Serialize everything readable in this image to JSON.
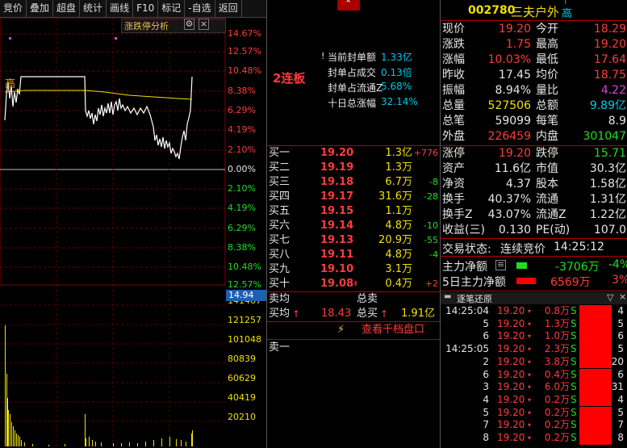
{
  "toolbar": {
    "items": [
      "竞价",
      "叠加",
      "超盘",
      "统计",
      "画线",
      "F10",
      "标记",
      "-自选",
      "返回"
    ]
  },
  "chart": {
    "panel_title": "涨跌停分析",
    "gear_icon": "⚙",
    "close_icon": "×",
    "high_marker": "高",
    "price_axis": [
      "14.67%",
      "12.57%",
      "10.48%",
      "8.38%",
      "6.29%",
      "4.19%",
      "2.10%",
      "0.00%",
      "2.10%",
      "4.19%",
      "6.29%",
      "8.38%",
      "10.48%",
      "12.57%"
    ],
    "volume_badge": "14.94",
    "volume_axis": [
      "141467",
      "121257",
      "101048",
      "80839",
      "60629",
      "40419",
      "20210"
    ]
  },
  "seal_info": {
    "streak": "2连板",
    "lines": [
      {
        "label": "当前封单额",
        "value": "1.33亿"
      },
      {
        "label": "封单占成交",
        "value": "0.13倍"
      },
      {
        "label": "封单占流通Z",
        "value": "5.68%"
      },
      {
        "label": "十日总涨幅",
        "value": "32.14%"
      }
    ]
  },
  "order_book": {
    "bids": [
      {
        "label": "买一",
        "price": "19.20",
        "vol": "1.3亿",
        "chg": "+776"
      },
      {
        "label": "买二",
        "price": "19.19",
        "vol": "1.3万",
        "chg": ""
      },
      {
        "label": "买三",
        "price": "19.18",
        "vol": "6.7万",
        "chg": "-8"
      },
      {
        "label": "买四",
        "price": "19.17",
        "vol": "31.6万",
        "chg": "-28"
      },
      {
        "label": "买五",
        "price": "19.15",
        "vol": "1.1万",
        "chg": ""
      },
      {
        "label": "买六",
        "price": "19.14",
        "vol": "4.8万",
        "chg": "-10"
      },
      {
        "label": "买七",
        "price": "19.13",
        "vol": "20.9万",
        "chg": "-55"
      },
      {
        "label": "买八",
        "price": "19.11",
        "vol": "4.8万",
        "chg": "-4"
      },
      {
        "label": "买九",
        "price": "19.10",
        "vol": "3.1万",
        "chg": ""
      },
      {
        "label": "买十",
        "price": "19.08",
        "vol": "0.4万",
        "chg": "+2"
      }
    ],
    "sell_avg_label": "卖均",
    "total_sell_label": "总卖",
    "buy_avg_label": "买均",
    "buy_avg_price": "18.43",
    "total_buy_label": "总买",
    "total_buy_value": "1.91亿",
    "thousand_btn": "查看千档盘口",
    "ask1_label": "卖一"
  },
  "stock": {
    "code": "002780",
    "name": "三夫户外",
    "flag": "高",
    "flag_top": "T"
  },
  "quote": [
    {
      "l1": "现价",
      "v1": "19.20",
      "c1": "red",
      "l2": "今开",
      "v2": "18.29",
      "c2": "red"
    },
    {
      "l1": "涨跌",
      "v1": "1.75",
      "c1": "red",
      "l2": "最高",
      "v2": "19.20",
      "c2": "red"
    },
    {
      "l1": "涨幅",
      "v1": "10.03%",
      "c1": "red",
      "l2": "最低",
      "v2": "17.64",
      "c2": "red"
    },
    {
      "l1": "昨收",
      "v1": "17.45",
      "c1": "white",
      "l2": "均价",
      "v2": "18.75",
      "c2": "red"
    },
    {
      "l1": "振幅",
      "v1": "8.94%",
      "c1": "white",
      "l2": "量比",
      "v2": "4.22",
      "c2": "magenta"
    },
    {
      "l1": "总量",
      "v1": "527506",
      "c1": "yellow",
      "l2": "总额",
      "v2": "9.89亿",
      "c2": "cyan"
    },
    {
      "l1": "总笔",
      "v1": "59099",
      "c1": "white",
      "l2": "每笔",
      "v2": "8.9",
      "c2": "white"
    },
    {
      "l1": "外盘",
      "v1": "226459",
      "c1": "red",
      "l2": "内盘",
      "v2": "301047",
      "c2": "green"
    },
    {
      "l1": "涨停",
      "v1": "19.20",
      "c1": "red",
      "l2": "跌停",
      "v2": "15.71",
      "c2": "green"
    },
    {
      "l1": "资产",
      "v1": "11.6亿",
      "c1": "white",
      "l2": "市值",
      "v2": "30.3亿",
      "c2": "white"
    },
    {
      "l1": "净资",
      "v1": "4.37",
      "c1": "white",
      "l2": "股本",
      "v2": "1.58亿",
      "c2": "white"
    },
    {
      "l1": "换手",
      "v1": "40.37%",
      "c1": "white",
      "l2": "流通",
      "v2": "1.31亿",
      "c2": "white"
    },
    {
      "l1": "换手Z",
      "v1": "43.07%",
      "c1": "white",
      "l2": "流通Z",
      "v2": "1.22亿",
      "c2": "white"
    },
    {
      "l1": "收益(三)",
      "v1": "0.130",
      "c1": "white",
      "l2": "PE(动)",
      "v2": "107.0",
      "c2": "white"
    }
  ],
  "status": {
    "label": "交易状态:",
    "value": "连续竞价",
    "time": "14:25:12"
  },
  "capital": {
    "main_label": "主力净额",
    "main_value": "-3706万",
    "main_pct": "-4%",
    "five_label": "5日主力净额",
    "five_value": "6569万",
    "five_pct": "3%"
  },
  "ticks_panel": {
    "title": "逐笔还原",
    "filter_icon": "filter-icon",
    "rows": [
      {
        "time": "14:25:04",
        "price": "19.20",
        "vol": "0.8万",
        "cnt": "4",
        "side": "S"
      },
      {
        "time": "5",
        "price": "19.20",
        "vol": "1.3万",
        "cnt": "5",
        "side": "S"
      },
      {
        "time": "6",
        "price": "19.20",
        "vol": "1.0万",
        "cnt": "6",
        "side": "S"
      },
      {
        "time": "14:25:05",
        "price": "19.20",
        "vol": "2.3万",
        "cnt": "5",
        "side": "S"
      },
      {
        "time": "2",
        "price": "19.20",
        "vol": "3.8万",
        "cnt": "20",
        "side": "S"
      },
      {
        "time": "6",
        "price": "19.20",
        "vol": "0.4万",
        "cnt": "6",
        "side": "S"
      },
      {
        "time": "3",
        "price": "19.20",
        "vol": "6.0万",
        "cnt": "31",
        "side": "S"
      },
      {
        "time": "4",
        "price": "19.20",
        "vol": "0.2万",
        "cnt": "4",
        "side": "S"
      },
      {
        "time": "5",
        "price": "19.20",
        "vol": "0.2万",
        "cnt": "5",
        "side": "S"
      },
      {
        "time": "7",
        "price": "19.20",
        "vol": "0.2万",
        "cnt": "7",
        "side": "S"
      },
      {
        "time": "8",
        "price": "19.20",
        "vol": "0.2万",
        "cnt": "8",
        "side": "S"
      }
    ]
  }
}
